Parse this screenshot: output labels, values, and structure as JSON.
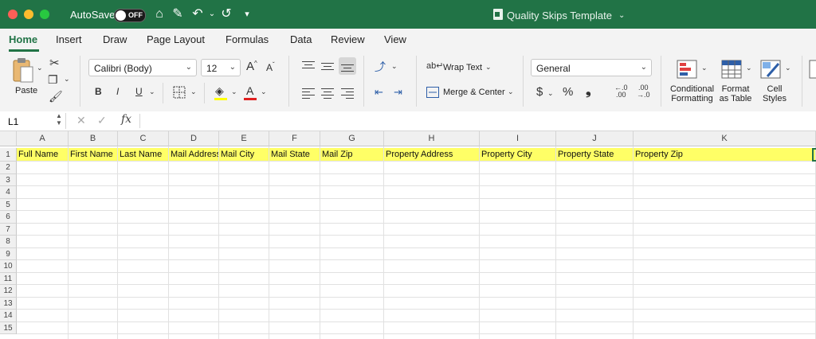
{
  "titlebar": {
    "autosave_label": "AutoSave",
    "autosave_state": "OFF",
    "document_title": "Quality Skips Template",
    "accent_color": "#217346"
  },
  "tabs": [
    {
      "label": "Home",
      "active": true
    },
    {
      "label": "Insert"
    },
    {
      "label": "Draw"
    },
    {
      "label": "Page Layout"
    },
    {
      "label": "Formulas"
    },
    {
      "label": "Data"
    },
    {
      "label": "Review"
    },
    {
      "label": "View"
    }
  ],
  "ribbon": {
    "paste_label": "Paste",
    "font_name": "Calibri (Body)",
    "font_size": "12",
    "bold": "B",
    "italic": "I",
    "underline": "U",
    "wrap_text": "Wrap Text",
    "merge_center": "Merge & Center",
    "number_format": "General",
    "currency": "$",
    "percent": "%",
    "comma": "❟",
    "conditional_formatting": [
      "Conditional",
      "Formatting"
    ],
    "format_as_table": [
      "Format",
      "as Table"
    ],
    "cell_styles": [
      "Cell",
      "Styles"
    ]
  },
  "formula_bar": {
    "name_box": "L1",
    "fx": "fx",
    "value": ""
  },
  "grid": {
    "columns": [
      "A",
      "B",
      "C",
      "D",
      "E",
      "F",
      "G",
      "H",
      "I",
      "J",
      "K"
    ],
    "rows": [
      "1",
      "2",
      "3",
      "4",
      "5",
      "6",
      "7",
      "8",
      "9",
      "10",
      "11",
      "12",
      "13",
      "14",
      "15"
    ],
    "row1_values": [
      "Full Name",
      "First Name",
      "Last Name",
      "Mail Address",
      "Mail City",
      "Mail State",
      "Mail Zip",
      "Property Address",
      "Property City",
      "Property State",
      "Property Zip"
    ],
    "header_fill": "#ffff66"
  }
}
